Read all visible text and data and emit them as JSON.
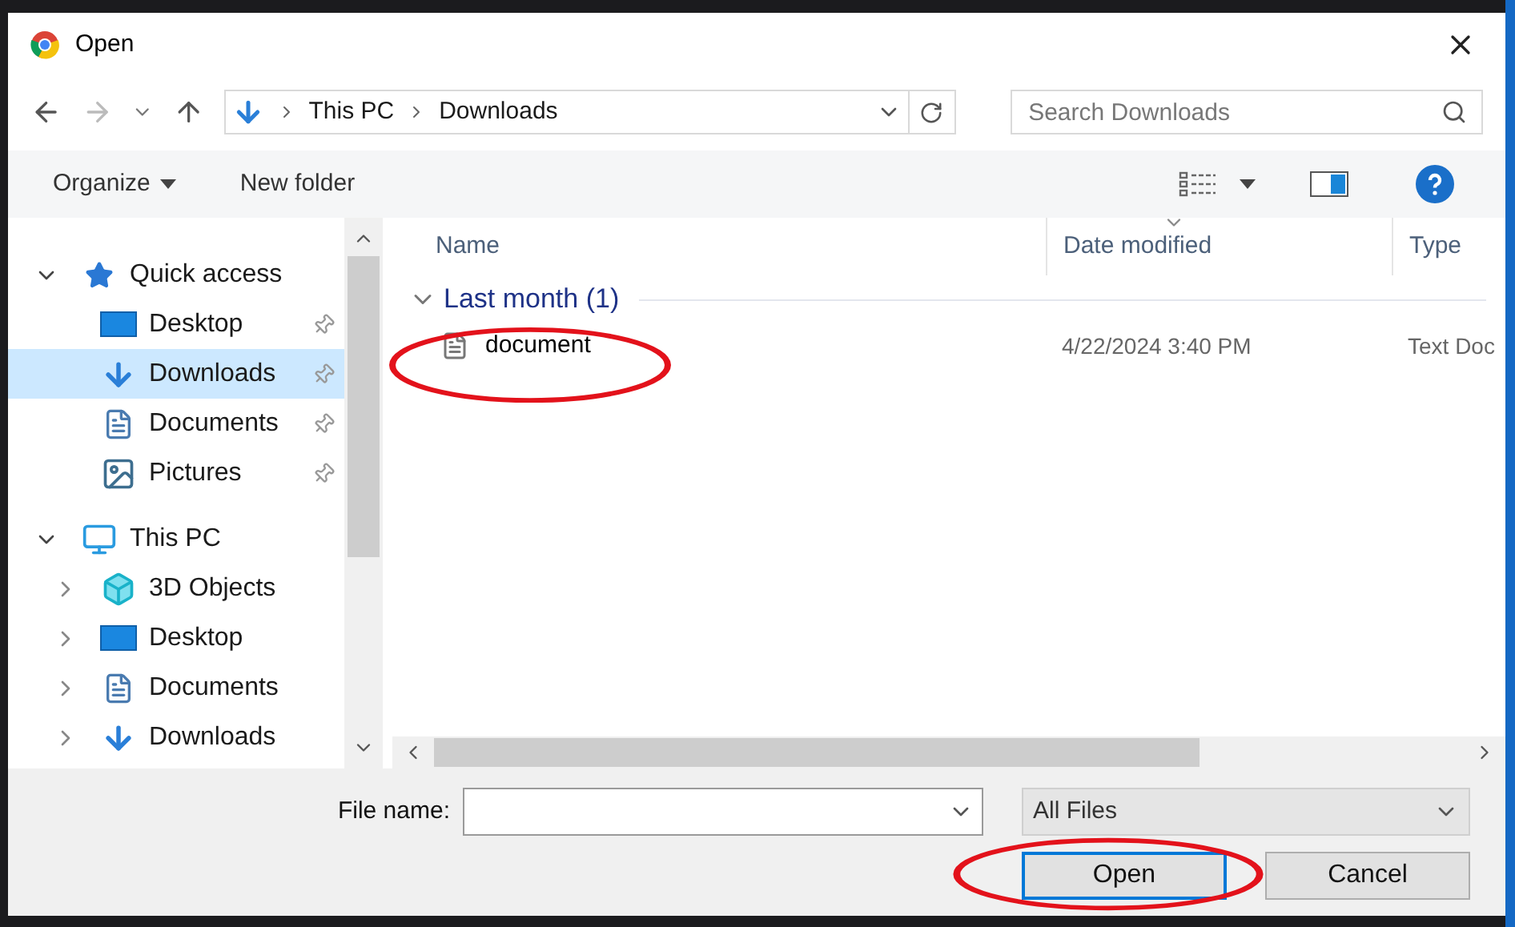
{
  "window": {
    "title": "Open"
  },
  "nav": {
    "path": [
      "This PC",
      "Downloads"
    ],
    "search": {
      "placeholder": "Search Downloads"
    }
  },
  "toolbar": {
    "buttons": [
      "Organize",
      "New folder"
    ]
  },
  "sidebar": {
    "items": [
      {
        "label": "Quick access",
        "expanded": true,
        "selected": false,
        "children": [
          {
            "label": "Desktop",
            "pinned": true,
            "selected": false
          },
          {
            "label": "Downloads",
            "pinned": true,
            "selected": true
          },
          {
            "label": "Documents",
            "pinned": true,
            "selected": false
          },
          {
            "label": "Pictures",
            "pinned": true,
            "selected": false
          }
        ]
      },
      {
        "label": "This PC",
        "expanded": true,
        "selected": false,
        "children": [
          {
            "label": "3D Objects",
            "expanded": false,
            "selected": false
          },
          {
            "label": "Desktop",
            "expanded": false,
            "selected": false
          },
          {
            "label": "Documents",
            "expanded": false,
            "selected": false
          },
          {
            "label": "Downloads",
            "expanded": false,
            "selected": false
          }
        ]
      }
    ]
  },
  "table": {
    "columns": [
      {
        "label": "Name",
        "sorted": false
      },
      {
        "label": "Date modified",
        "sorted": true
      },
      {
        "label": "Type",
        "sorted": false
      }
    ],
    "groups": [
      {
        "label": "Last month (1)",
        "expanded": true,
        "rows": [
          {
            "name": "document",
            "date": "4/22/2024 3:40 PM",
            "type": "Text Doc"
          }
        ]
      }
    ]
  },
  "footer": {
    "file_name_label": "File name:",
    "filter": "All Files",
    "buttons": [
      {
        "label": "Open",
        "default": true
      },
      {
        "label": "Cancel",
        "default": false
      }
    ]
  },
  "annotations": [
    {
      "kind": "ellipse"
    },
    {
      "kind": "ellipse"
    }
  ]
}
